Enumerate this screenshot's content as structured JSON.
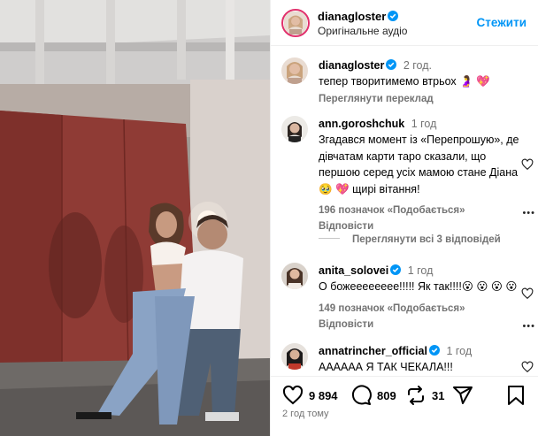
{
  "header": {
    "username": "dianagloster",
    "subtitle": "Оригінальне аудіо",
    "follow_label": "Стежити"
  },
  "caption": {
    "username": "dianagloster",
    "time": "2 год.",
    "text": "тепер творитимемо втрьох 🤰 💖",
    "translate_label": "Переглянути переклад"
  },
  "comments": [
    {
      "username": "ann.goroshchuk",
      "verified": false,
      "time": "1 год",
      "text": "Згадався момент із «Перепрошую», де дівчатам карти таро сказали, що першою серед усіх мамою стане Діана 🥹 💖 щирі вітання!",
      "likes": "196 позначок «Подобається»",
      "reply_label": "Відповісти",
      "replies_label": "Переглянути всі 3 відповідей"
    },
    {
      "username": "anita_solovei",
      "verified": true,
      "time": "1 год",
      "text": "О божееееееее!!!!! Як так!!!!😮 😮 😮 😮",
      "likes": "149 позначок «Подобається»",
      "reply_label": "Відповісти"
    },
    {
      "username": "annatrincher_official",
      "verified": true,
      "time": "1 год",
      "text": "АААААА Я ТАК ЧЕКАЛА!!!"
    }
  ],
  "actions": {
    "likes": "9 894",
    "comments": "809",
    "reposts": "31"
  },
  "posted_ago": "2 год тому",
  "colors": {
    "accent": "#0095f6",
    "verified": "#0095f6",
    "muted": "#737373",
    "divider": "#efefef"
  },
  "icons": [
    "heart-icon",
    "comment-icon",
    "repost-icon",
    "share-icon",
    "bookmark-icon",
    "verified-icon",
    "more-icon"
  ]
}
